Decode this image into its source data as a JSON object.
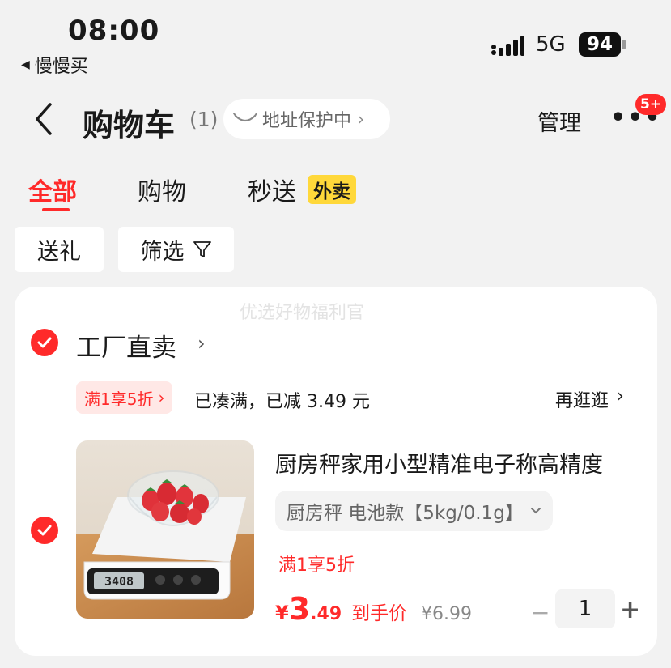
{
  "status_bar": {
    "time": "08:00",
    "back_app": "慢慢买",
    "network": "5G",
    "battery": "94"
  },
  "nav": {
    "title": "购物车",
    "count": "(1)",
    "address_protect": "地址保护中",
    "manage": "管理",
    "more": "•••",
    "badge": "5+"
  },
  "tabs": [
    {
      "label": "全部",
      "active": true
    },
    {
      "label": "购物"
    },
    {
      "label": "秒送",
      "tag": "外卖"
    }
  ],
  "filters": {
    "gift": "送礼",
    "filter": "筛选"
  },
  "card": {
    "watermark": "优选好物福利官",
    "store_name": "工厂直卖",
    "promo_tag": "满1享5折",
    "promo_status": "已凑满，已减 3.49 元",
    "shop_more": "再逛逛",
    "product": {
      "name": "厨房秤家用小型精准电子称高精度",
      "spec": "厨房秤 电池款【5kg/0.1g】",
      "promo": "满1享5折",
      "price_symbol": "¥",
      "price_int": "3",
      "price_dec": ".49",
      "price_label": "到手价",
      "original_price": "¥6.99",
      "quantity": "1",
      "scale_display": "3408"
    }
  },
  "colors": {
    "accent": "#ff2a2a",
    "waimai_bg": "#ffd83a",
    "page_bg": "#f2f2f2"
  }
}
